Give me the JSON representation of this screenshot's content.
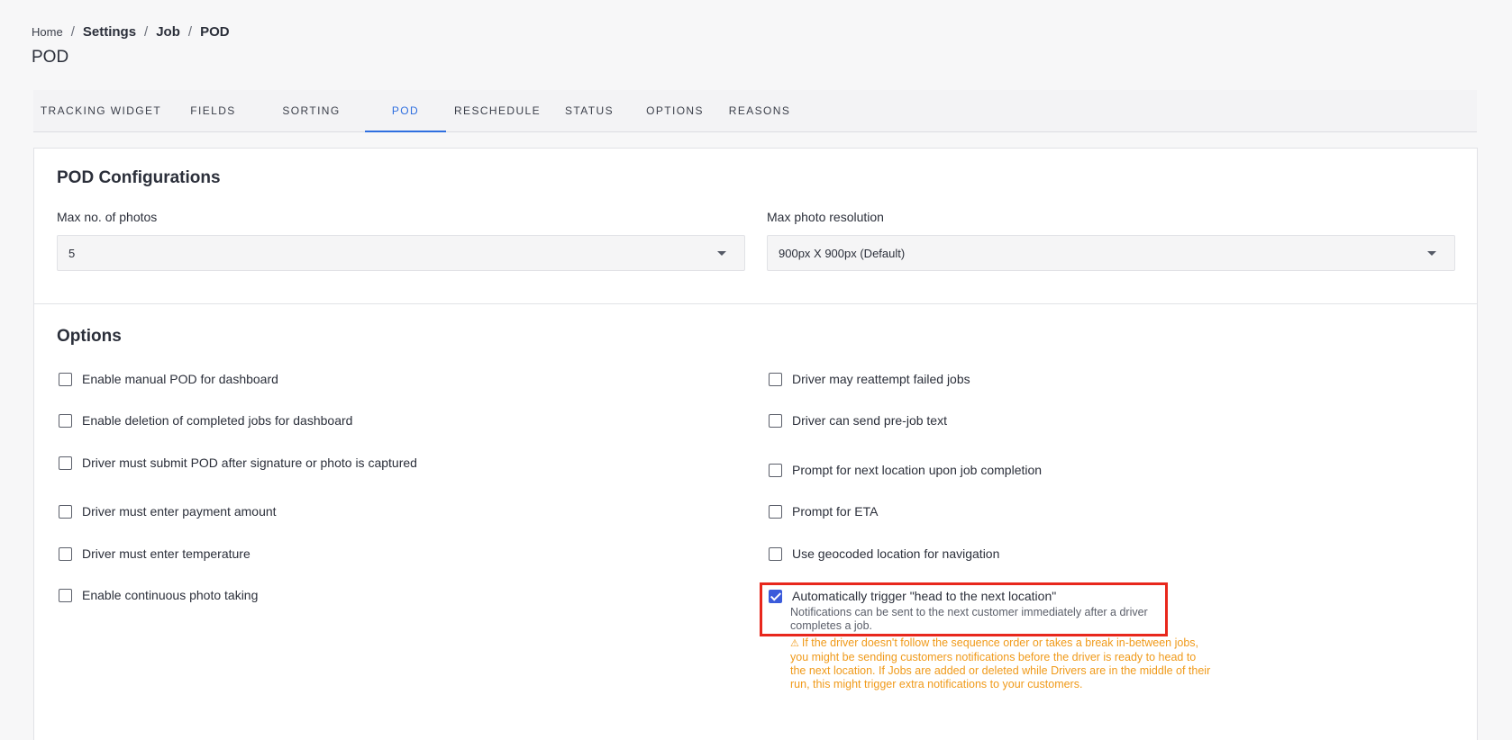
{
  "breadcrumb": {
    "home": "Home",
    "settings": "Settings",
    "job": "Job",
    "current": "POD"
  },
  "page_title": "POD",
  "tabs": [
    {
      "label": "TRACKING WIDGET",
      "active": false
    },
    {
      "label": "FIELDS",
      "active": false
    },
    {
      "label": "SORTING",
      "active": false
    },
    {
      "label": "POD",
      "active": true
    },
    {
      "label": "RESCHEDULE",
      "active": false
    },
    {
      "label": "STATUS",
      "active": false
    },
    {
      "label": "OPTIONS",
      "active": false
    },
    {
      "label": "REASONS",
      "active": false
    }
  ],
  "pod_config": {
    "title": "POD Configurations",
    "max_photos_label": "Max no. of photos",
    "max_photos_value": "5",
    "max_resolution_label": "Max photo resolution",
    "max_resolution_value": "900px X 900px (Default)"
  },
  "options": {
    "title": "Options",
    "left": [
      {
        "label": "Enable manual POD for dashboard",
        "checked": false
      },
      {
        "label": "Enable deletion of completed jobs for dashboard",
        "checked": false
      },
      {
        "label": "Driver must submit POD after signature or photo is captured",
        "checked": false
      },
      {
        "label": "Driver must enter payment amount",
        "checked": false
      },
      {
        "label": "Driver must enter temperature",
        "checked": false
      },
      {
        "label": "Enable continuous photo taking",
        "checked": false
      }
    ],
    "right": [
      {
        "label": "Driver may reattempt failed jobs",
        "checked": false
      },
      {
        "label": "Driver can send pre-job text",
        "checked": false
      },
      {
        "label": "Prompt for next location upon job completion",
        "checked": false
      },
      {
        "label": "Prompt for ETA",
        "checked": false
      },
      {
        "label": "Use geocoded location for navigation",
        "checked": false
      },
      {
        "label": "Automatically trigger \"head to the next location\"",
        "checked": true
      }
    ],
    "auto_trigger_description": "Notifications can be sent to the next customer immediately after a driver completes a job.",
    "auto_trigger_warning": "If the driver doesn't follow the sequence order or takes a break in-between jobs, you might be sending customers notifications before the driver is ready to head to the next location. If Jobs are added or deleted while Drivers are in the middle of their run, this might trigger extra notifications to your customers."
  },
  "colors": {
    "accent": "#2f6fe0",
    "checkbox_checked": "#3b5bdb",
    "highlight_border": "#e8271c",
    "warning": "#f09a1a"
  }
}
